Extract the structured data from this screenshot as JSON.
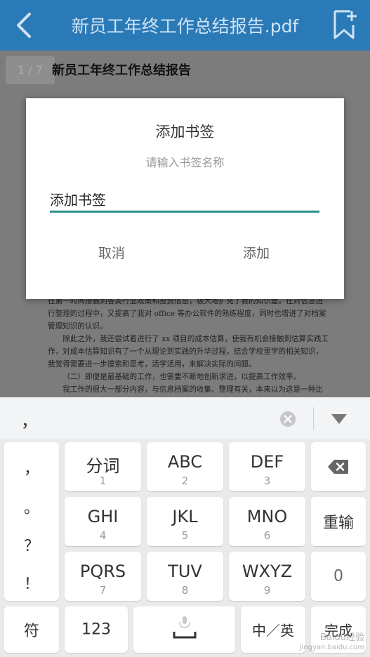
{
  "appbar": {
    "title": "新员工年终工作总结报告.pdf"
  },
  "document": {
    "page_indicator": "1 / 7",
    "title": "新员工年终工作总结报告",
    "paragraphs": [
      "在第一时间接触到各类行业政策和投资信息，极大地扩充了我的知识量。在对信息进行整理的过程中，又提高了我对 office 等办公软件的熟练程度，同时也增进了对档案管理知识的认识。",
      "除此之外，我还尝试着进行了 xx 项目的成本估算，使我有机会接触到估算实践工作，对成本估算知识有了一个从理论到实践的升华过程，结合学校里学的相关知识，我觉得需要进一步摸索和思考，活学活用，来解决实际的问题。",
      "（二）即便是最基础的工作，也需要不断地创新求进，以提高工作效率。",
      "我工作的很大一部分内容，与信息档案的收集、整理有关，本来以为这是一种比较枯燥的工作，其实，如果有心多思考一下，档案管理也会更赋予人性化。接触工作至今，我发现需要保存的资料类目繁多、信息量大。于是，我在按常规进行整理的同时对一些资料从地"
    ]
  },
  "dialog": {
    "title": "添加书签",
    "subtitle": "请输入书签名称",
    "input_value": "添加书签",
    "cancel_label": "取消",
    "add_label": "添加"
  },
  "keyboard": {
    "candidate": "，",
    "symbols": [
      "，",
      "。",
      "？",
      "！"
    ],
    "keys": [
      {
        "main": "分词",
        "num": "1"
      },
      {
        "main": "ABC",
        "num": "2"
      },
      {
        "main": "DEF",
        "num": "3"
      },
      {
        "main": "GHI",
        "num": "4"
      },
      {
        "main": "JKL",
        "num": "5"
      },
      {
        "main": "MNO",
        "num": "6"
      },
      {
        "main": "PQRS",
        "num": "7"
      },
      {
        "main": "TUV",
        "num": "8"
      },
      {
        "main": "WXYZ",
        "num": "9"
      }
    ],
    "retype_label": "重输",
    "zero_label": "0",
    "symbol_label": "符",
    "num_label": "123",
    "lang_label": "中／英",
    "done_label": "完成"
  },
  "watermark": {
    "line1": "Baidu经验",
    "line2": "jingyan.baidu.com"
  },
  "colors": {
    "appbar": "#2b7ab8",
    "input_underline": "#2a8f8a",
    "keyboard_bg": "#e9eaec"
  }
}
